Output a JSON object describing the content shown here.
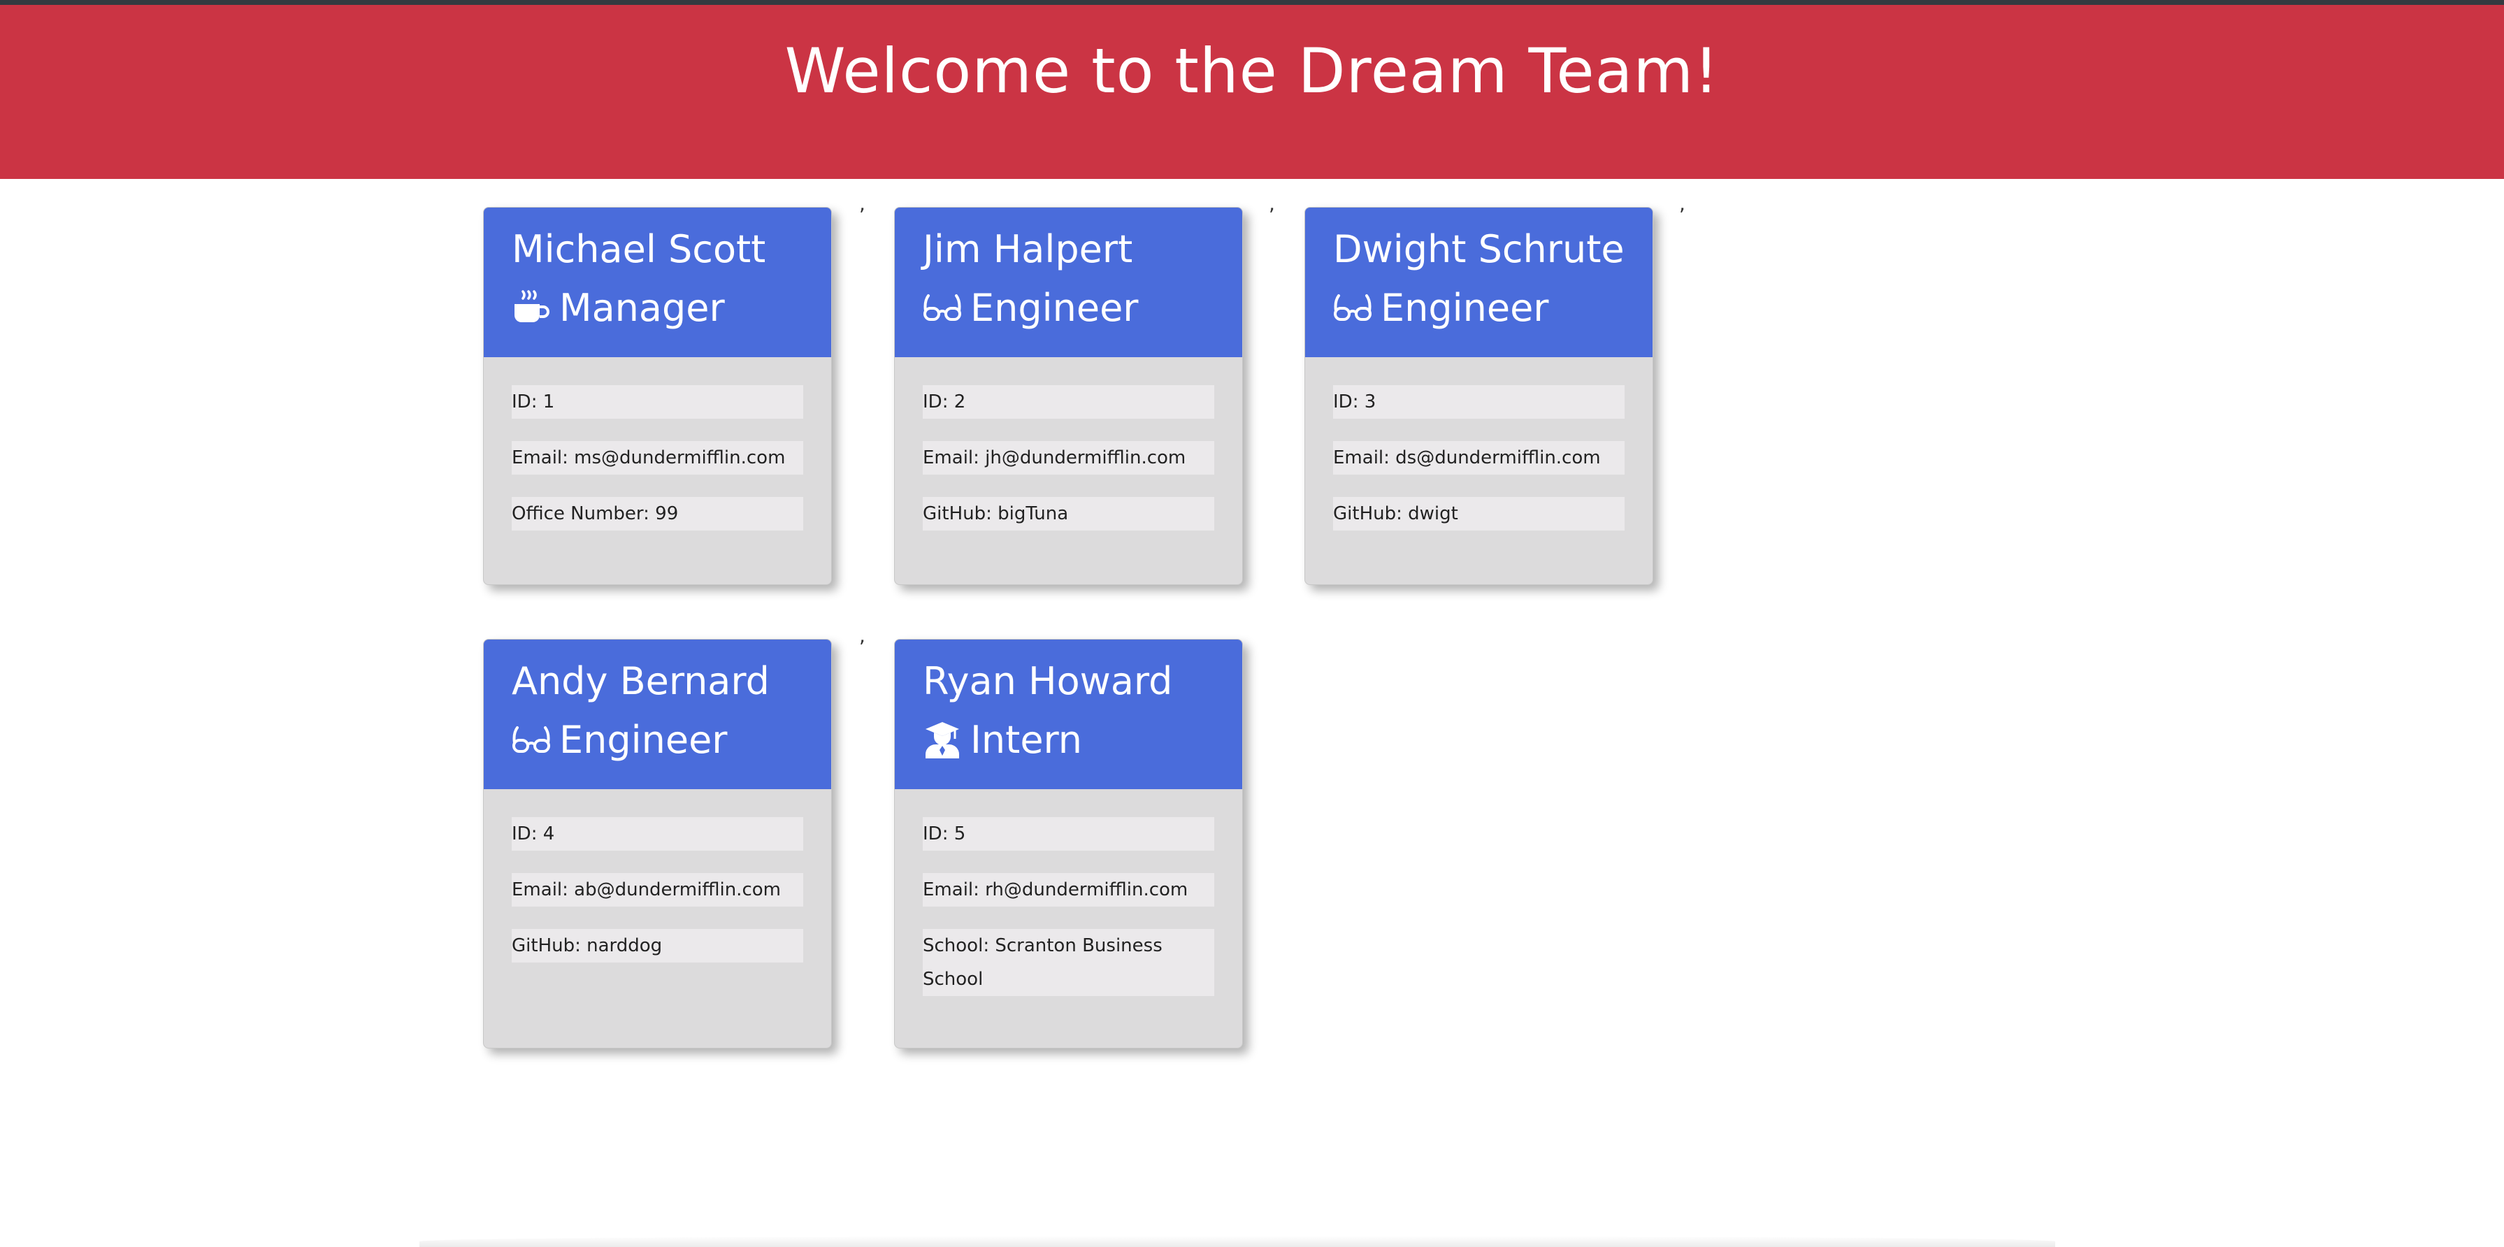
{
  "header": {
    "title": "Welcome to the Dream Team!",
    "background_color": "#cb3444"
  },
  "separator_text": ",",
  "accent_color": "#4a6cdb",
  "employees": [
    {
      "name": "Michael Scott",
      "role": "Manager",
      "icon": "coffee-icon",
      "fields": [
        "ID: 1",
        "Email: ms@dundermifflin.com",
        "Office Number: 99"
      ]
    },
    {
      "name": "Jim Halpert",
      "role": "Engineer",
      "icon": "glasses-icon",
      "fields": [
        "ID: 2",
        "Email: jh@dundermifflin.com",
        "GitHub: bigTuna"
      ]
    },
    {
      "name": "Dwight Schrute",
      "role": "Engineer",
      "icon": "glasses-icon",
      "fields": [
        "ID: 3",
        "Email: ds@dundermifflin.com",
        "GitHub: dwigt"
      ]
    },
    {
      "name": "Andy Bernard",
      "role": "Engineer",
      "icon": "glasses-icon",
      "fields": [
        "ID: 4",
        "Email: ab@dundermifflin.com",
        "GitHub: narddog"
      ]
    },
    {
      "name": "Ryan Howard",
      "role": "Intern",
      "icon": "graduate-icon",
      "fields": [
        "ID: 5",
        "Email: rh@dundermifflin.com",
        "School: Scranton Business School"
      ]
    }
  ]
}
